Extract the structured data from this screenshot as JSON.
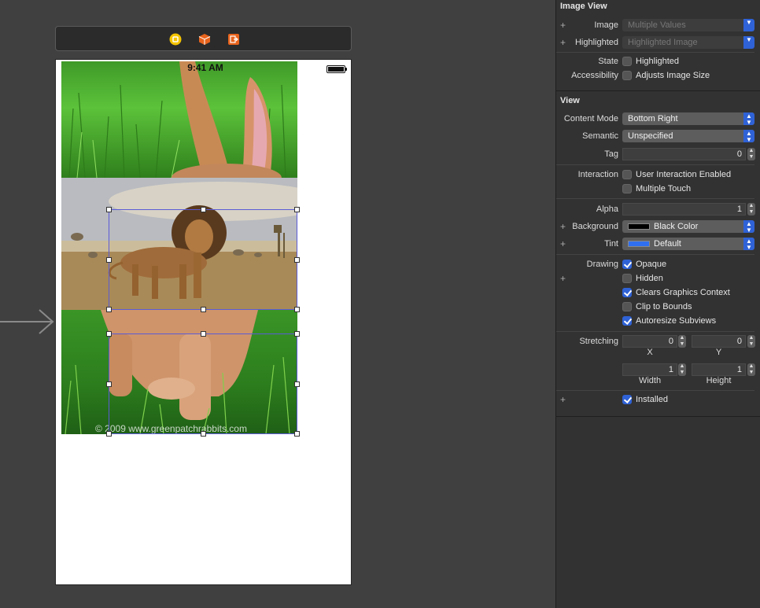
{
  "device": {
    "status_time": "9:41 AM",
    "watermark": "© 2009 www.greenpatchrabbits.com"
  },
  "scene_bar": {
    "icons": [
      "view-controller-icon",
      "first-responder-cube-icon",
      "exit-icon"
    ]
  },
  "inspector": {
    "image_view": {
      "title": "Image View",
      "image_label": "Image",
      "image_value": "Multiple Values",
      "highlighted_label": "Highlighted",
      "highlighted_value": "Highlighted Image",
      "state_label": "State",
      "state_option": "Highlighted",
      "state_checked": false,
      "accessibility_label": "Accessibility",
      "accessibility_option": "Adjusts Image Size",
      "accessibility_checked": false
    },
    "view": {
      "title": "View",
      "content_mode_label": "Content Mode",
      "content_mode_value": "Bottom Right",
      "semantic_label": "Semantic",
      "semantic_value": "Unspecified",
      "tag_label": "Tag",
      "tag_value": "0",
      "interaction_label": "Interaction",
      "user_interaction_label": "User Interaction Enabled",
      "user_interaction_checked": false,
      "multiple_touch_label": "Multiple Touch",
      "multiple_touch_checked": false,
      "alpha_label": "Alpha",
      "alpha_value": "1",
      "background_label": "Background",
      "background_value": "Black Color",
      "background_color": "#000000",
      "tint_label": "Tint",
      "tint_value": "Default",
      "tint_color": "#2f6ff0",
      "drawing_label": "Drawing",
      "opaque_label": "Opaque",
      "opaque_checked": true,
      "hidden_label": "Hidden",
      "hidden_checked": false,
      "clears_label": "Clears Graphics Context",
      "clears_checked": true,
      "clip_label": "Clip to Bounds",
      "clip_checked": false,
      "autoresize_label": "Autoresize Subviews",
      "autoresize_checked": true,
      "stretching_label": "Stretching",
      "stretch_x": "0",
      "stretch_y": "0",
      "stretch_x_caption": "X",
      "stretch_y_caption": "Y",
      "stretch_width": "1",
      "stretch_height": "1",
      "stretch_width_caption": "Width",
      "stretch_height_caption": "Height",
      "installed_label": "Installed",
      "installed_checked": true
    }
  },
  "colors": {
    "selection": "#5b5bd6",
    "accent": "#2f62d6"
  }
}
